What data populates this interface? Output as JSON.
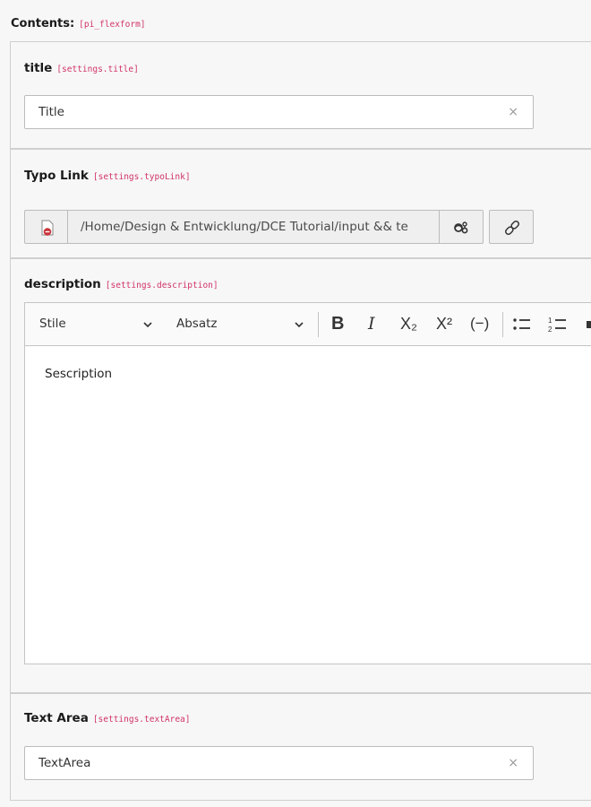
{
  "contents": {
    "label": "Contents:",
    "key": "[pi_flexform]"
  },
  "title_field": {
    "label": "title",
    "key": "[settings.title]",
    "value": "Title",
    "clear_icon": "×"
  },
  "typolink_field": {
    "label": "Typo Link",
    "key": "[settings.typoLink]",
    "value": "/Home/Design & Entwicklung/DCE Tutorial/input && te",
    "file_icon": "file-remove-icon",
    "wizard_icon": "link-wizard-icon",
    "link_icon": "link-icon"
  },
  "description_field": {
    "label": "description",
    "key": "[settings.description]",
    "toolbar": {
      "style_dropdown": "Stile",
      "format_dropdown": "Absatz",
      "bold": "B",
      "italic": "I",
      "subscript": "X₂",
      "superscript": "X²",
      "softhyphen": "(−)"
    },
    "content": "Sescription"
  },
  "textarea_field": {
    "label": "Text Area",
    "key": "[settings.textArea]",
    "value": "TextArea",
    "clear_icon": "×"
  },
  "colors": {
    "code": "#d1336a",
    "file_icon_red": "#c8343a"
  }
}
